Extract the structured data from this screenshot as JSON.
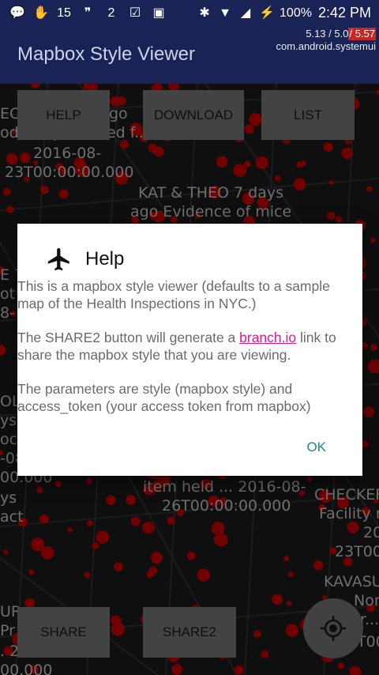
{
  "status_bar": {
    "notifications": [
      {
        "icon": "messenger-icon",
        "glyph": "💬"
      },
      {
        "icon": "hand-icon",
        "glyph": "✋"
      },
      {
        "icon": "calendar-15-icon",
        "glyph": "15"
      },
      {
        "icon": "chat-bubble-icon",
        "glyph": "❞"
      },
      {
        "icon": "badge-2-icon",
        "glyph": "2"
      },
      {
        "icon": "checklist-icon",
        "glyph": "☑"
      },
      {
        "icon": "image-icon",
        "glyph": "▣"
      }
    ],
    "battery": "100%",
    "time": "2:42 PM"
  },
  "app": {
    "title": "Mapbox Style Viewer"
  },
  "cpu_overlay": {
    "load_a": "5.13 / 5.0",
    "load_b": "5.57",
    "process": "com.android.systemui"
  },
  "buttons": {
    "help": "HELP",
    "download": "DOWNLOAD",
    "list": "LIST",
    "share": "SHARE",
    "share2": "SHARE2"
  },
  "map_labels": [
    {
      "id": "l1",
      "text": "EC"
    },
    {
      "id": "l2",
      "text": "go"
    },
    {
      "id": "l3",
      "text": "od not protected f..."
    },
    {
      "id": "l4",
      "text": "2016-08-"
    },
    {
      "id": "l5",
      "text": "23T00:00:00.000"
    },
    {
      "id": "l6",
      "text": "KAT & THEO 7 days"
    },
    {
      "id": "l7",
      "text": "ago Evidence of mice"
    },
    {
      "id": "l8",
      "text": "E 7"
    },
    {
      "id": "l9",
      "text": "ot"
    },
    {
      "id": "l10",
      "text": "8-"
    },
    {
      "id": "l11",
      "text": "OLE"
    },
    {
      "id": "l12",
      "text": "ys a"
    },
    {
      "id": "l13",
      "text": "oce"
    },
    {
      "id": "l14",
      "text": "-08"
    },
    {
      "id": "l15",
      "text": "00.000"
    },
    {
      "id": "l16",
      "text": "ys"
    },
    {
      "id": "l17",
      "text": "act"
    },
    {
      "id": "l18",
      "text": "item held ... 2016-08-"
    },
    {
      "id": "l19",
      "text": "26T00:00:00.000"
    },
    {
      "id": "l20",
      "text": "CHECKEF"
    },
    {
      "id": "l21",
      "text": "Facility r"
    },
    {
      "id": "l22",
      "text": "20"
    },
    {
      "id": "l23",
      "text": "23T00"
    },
    {
      "id": "l24",
      "text": "KAVASU"
    },
    {
      "id": "l25",
      "text": "Non"
    },
    {
      "id": "l26",
      "text": "r..."
    },
    {
      "id": "l27",
      "text": "T00"
    },
    {
      "id": "l28",
      "text": "UR"
    },
    {
      "id": "l29",
      "text": "Pr"
    },
    {
      "id": "l30",
      "text": ". 2016-08-"
    },
    {
      "id": "l31",
      "text": "00.000"
    }
  ],
  "dialog": {
    "title": "Help",
    "p1": "This is a mapbox style viewer (defaults to a sample map of the Health Inspections in NYC.)",
    "p2_before": "The SHARE2 button will generate a ",
    "p2_link": "branch.io",
    "p2_after": " link to share the mapbox style that you are viewing.",
    "p3": "The parameters are style (mapbox style) and access_token (your access token from mapbox)",
    "ok": "OK"
  },
  "colors": {
    "appbar": "#1a2355",
    "dialog_ok": "#1f8a7e",
    "link": "#d81b8a",
    "dots": "#cc0000"
  }
}
